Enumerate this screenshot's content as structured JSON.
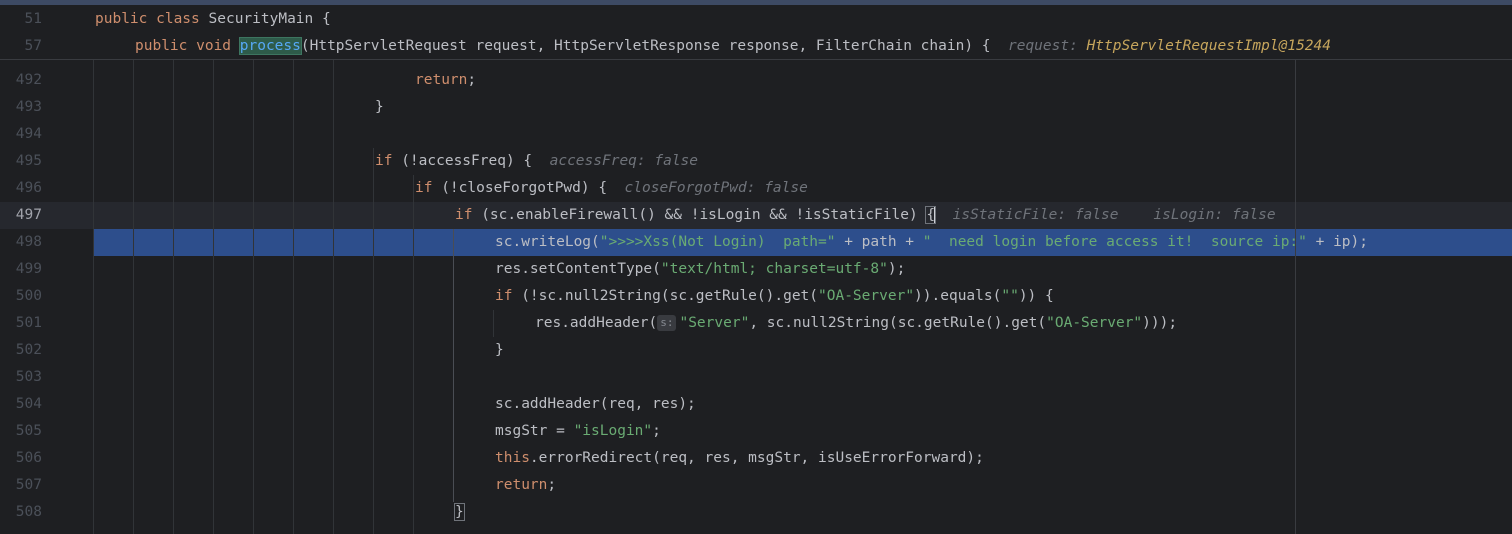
{
  "sticky": [
    {
      "line": "51",
      "tokens": [
        {
          "t": "public class ",
          "c": "kw"
        },
        {
          "t": "SecurityMain {",
          "c": "plain"
        }
      ]
    },
    {
      "line": "57",
      "tokens": [
        {
          "t": "public void ",
          "c": "kw"
        },
        {
          "t": "process",
          "c": "hlmeth"
        },
        {
          "t": "(HttpServletRequest request, HttpServletResponse response, FilterChain chain) {  ",
          "c": "plain"
        },
        {
          "t": "request: ",
          "c": "hint"
        },
        {
          "t": "HttpServletRequestImpl@15244",
          "c": "hintval"
        }
      ]
    }
  ],
  "partial_line": "(       )      ;       ;       ;       (",
  "lines": [
    {
      "line": "492",
      "tokens": [
        {
          "t": "return",
          "c": "kw"
        },
        {
          "t": ";",
          "c": "plain"
        }
      ]
    },
    {
      "line": "493",
      "tokens": [
        {
          "t": "}",
          "c": "plain"
        }
      ]
    },
    {
      "line": "494",
      "tokens": []
    },
    {
      "line": "495",
      "tokens": [
        {
          "t": "if ",
          "c": "kw"
        },
        {
          "t": "(!accessFreq) {  ",
          "c": "plain"
        },
        {
          "t": "accessFreq: false",
          "c": "hint"
        }
      ]
    },
    {
      "line": "496",
      "tokens": [
        {
          "t": "if ",
          "c": "kw"
        },
        {
          "t": "(!closeForgotPwd) {  ",
          "c": "plain"
        },
        {
          "t": "closeForgotPwd: false",
          "c": "hint"
        }
      ]
    },
    {
      "line": "497",
      "tokens": [
        {
          "t": "if ",
          "c": "kw"
        },
        {
          "t": "(sc.enableFirewall() && !isLogin && !isStaticFile) ",
          "c": "plain"
        },
        {
          "t": "{",
          "c": "brace"
        },
        {
          "t": "",
          "c": "caret"
        },
        {
          "t": "  isStaticFile: false    isLogin: false",
          "c": "hint"
        }
      ]
    },
    {
      "line": "498",
      "tokens": [
        {
          "t": "sc.writeLog(",
          "c": "plain"
        },
        {
          "t": "\">>>>Xss(Not Login)  path=\"",
          "c": "str"
        },
        {
          "t": " + path + ",
          "c": "plain"
        },
        {
          "t": "\"  need login before access it!  source ip:\"",
          "c": "str"
        },
        {
          "t": " + ip);",
          "c": "plain"
        }
      ]
    },
    {
      "line": "499",
      "tokens": [
        {
          "t": "res.setContentType(",
          "c": "plain"
        },
        {
          "t": "\"text/html; charset=utf-8\"",
          "c": "str"
        },
        {
          "t": ");",
          "c": "plain"
        }
      ]
    },
    {
      "line": "500",
      "tokens": [
        {
          "t": "if ",
          "c": "kw"
        },
        {
          "t": "(!sc.null2String(sc.getRule().get(",
          "c": "plain"
        },
        {
          "t": "\"OA-Server\"",
          "c": "str"
        },
        {
          "t": ")).equals(",
          "c": "plain"
        },
        {
          "t": "\"\"",
          "c": "str"
        },
        {
          "t": ")) {",
          "c": "plain"
        }
      ]
    },
    {
      "line": "501",
      "tokens": [
        {
          "t": "res.addHeader(",
          "c": "plain"
        },
        {
          "t": "s:",
          "c": "param"
        },
        {
          "t": "\"Server\"",
          "c": "str"
        },
        {
          "t": ", sc.null2String(sc.getRule().get(",
          "c": "plain"
        },
        {
          "t": "\"OA-Server\"",
          "c": "str"
        },
        {
          "t": ")));",
          "c": "plain"
        }
      ]
    },
    {
      "line": "502",
      "tokens": [
        {
          "t": "}",
          "c": "plain"
        }
      ]
    },
    {
      "line": "503",
      "tokens": []
    },
    {
      "line": "504",
      "tokens": [
        {
          "t": "sc.addHeader(req, res);",
          "c": "plain"
        }
      ]
    },
    {
      "line": "505",
      "tokens": [
        {
          "t": "msgStr = ",
          "c": "plain"
        },
        {
          "t": "\"isLogin\"",
          "c": "str"
        },
        {
          "t": ";",
          "c": "plain"
        }
      ]
    },
    {
      "line": "506",
      "tokens": [
        {
          "t": "this",
          "c": "kw"
        },
        {
          "t": ".errorRedirect(req, res, msgStr, isUseErrorForward);",
          "c": "plain"
        }
      ]
    },
    {
      "line": "507",
      "tokens": [
        {
          "t": "return",
          "c": "kw"
        },
        {
          "t": ";",
          "c": "plain"
        }
      ]
    },
    {
      "line": "508",
      "tokens": [
        {
          "t": "}",
          "c": "brace"
        }
      ]
    }
  ]
}
